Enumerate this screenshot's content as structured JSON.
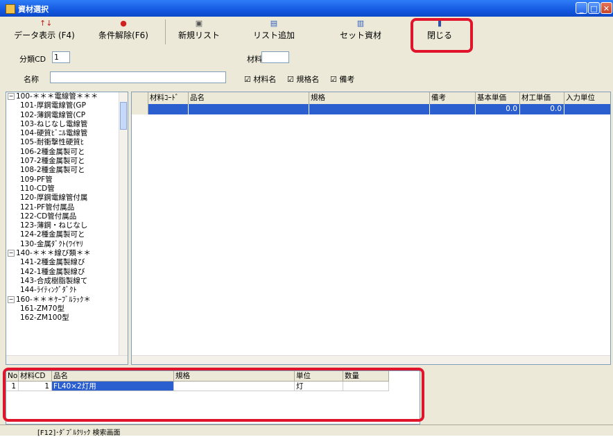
{
  "window": {
    "title": "資材選択"
  },
  "toolbar": {
    "data_display": "データ表示 (F4)",
    "clear_filter": "条件解除(F6)",
    "new_list": "新規リスト",
    "add_list": "リスト追加",
    "set_material": "セット資材",
    "close": "閉じる"
  },
  "filters": {
    "category_label": "分類CD",
    "category_value": "1",
    "material_cd_label": "材料CD",
    "material_cd_value": "",
    "name_label": "名称",
    "name_value": "",
    "check_material_name": "材料名",
    "check_spec_name": "規格名",
    "check_remarks": "備考"
  },
  "tree": [
    {
      "text": "100-＊＊＊電線管＊＊＊",
      "group": true
    },
    {
      "text": "101-厚鋼電線管(GP",
      "group": false
    },
    {
      "text": "102-薄鋼電線管(CP",
      "group": false
    },
    {
      "text": "103-ねじなし電線管",
      "group": false
    },
    {
      "text": "104-硬質ﾋﾞﾆﾙ電線管",
      "group": false
    },
    {
      "text": "105-耐衝撃性硬質ﾋ",
      "group": false
    },
    {
      "text": "106-2種金属製可と",
      "group": false
    },
    {
      "text": "107-2種金属製可と",
      "group": false
    },
    {
      "text": "108-2種金属製可と",
      "group": false
    },
    {
      "text": "109-PF管",
      "group": false
    },
    {
      "text": "110-CD管",
      "group": false
    },
    {
      "text": "120-厚鋼電線管付属",
      "group": false
    },
    {
      "text": "121-PF管付属品",
      "group": false
    },
    {
      "text": "122-CD管付属品",
      "group": false
    },
    {
      "text": "123-薄鋼・ねじなし",
      "group": false
    },
    {
      "text": "124-2種金属製可と",
      "group": false
    },
    {
      "text": "130-金属ﾀﾞｸﾄ(ﾜｲﾔﾘ",
      "group": false
    },
    {
      "text": "140-＊＊＊線び類＊＊",
      "group": true
    },
    {
      "text": "141-2種金属製線び",
      "group": false
    },
    {
      "text": "142-1種金属製線び",
      "group": false
    },
    {
      "text": "143-合成樹脂製線て",
      "group": false
    },
    {
      "text": "144-ﾗｲﾃｨﾝｸﾞﾀﾞｸﾄ",
      "group": false
    },
    {
      "text": "160-＊＊＊ｹｰﾌﾞﾙﾗｯｸ＊",
      "group": true
    },
    {
      "text": "161-ZM70型",
      "group": false
    },
    {
      "text": "162-ZM100型",
      "group": false
    }
  ],
  "grid": {
    "headers": [
      "材料ｺｰﾄﾞ",
      "品名",
      "規格",
      "備考",
      "基本単価",
      "材工単価",
      "入力単位"
    ],
    "row": [
      "",
      "",
      "",
      "",
      "0.0",
      "0.0",
      ""
    ]
  },
  "list": {
    "headers": [
      "No",
      "材料CD",
      "品名",
      "規格",
      "単位",
      "数量"
    ],
    "row": [
      "1",
      "1",
      "FL40×2灯用",
      "",
      "灯",
      ""
    ]
  },
  "status": {
    "hint": "[F12]･ﾀﾞﾌﾞﾙｸﾘｯｸ 検索画面"
  },
  "colors": {
    "selection": "#2b5fcf",
    "highlight": "#e0142a",
    "titlebar": "#1458e0"
  }
}
